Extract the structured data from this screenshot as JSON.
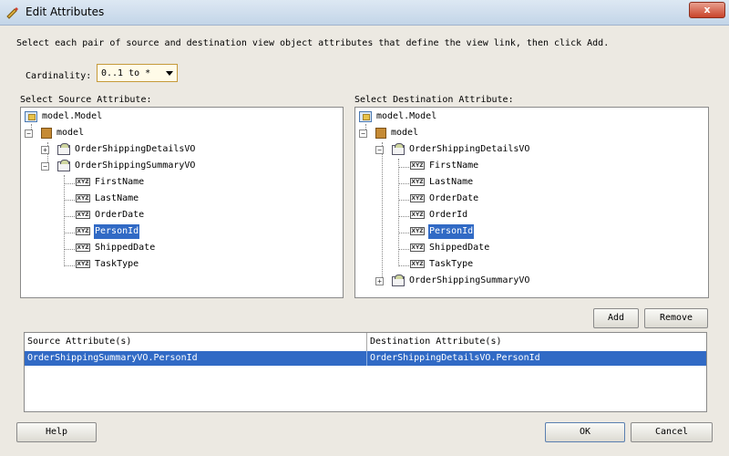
{
  "window": {
    "title": "Edit Attributes",
    "close_label": "x"
  },
  "instructions": "Select each pair of source and destination view object attributes that define the view link, then click Add.",
  "cardinality": {
    "label": "Cardinality:",
    "value": "0..1 to *"
  },
  "source": {
    "label": "Select Source Attribute:",
    "nodes": [
      "model.Model",
      "model",
      "OrderShippingDetailsVO",
      "OrderShippingSummaryVO",
      "FirstName",
      "LastName",
      "OrderDate",
      "PersonId",
      "ShippedDate",
      "TaskType"
    ],
    "selected": "PersonId"
  },
  "destination": {
    "label": "Select Destination Attribute:",
    "nodes": [
      "model.Model",
      "model",
      "OrderShippingDetailsVO",
      "FirstName",
      "LastName",
      "OrderDate",
      "OrderId",
      "PersonId",
      "ShippedDate",
      "TaskType",
      "OrderShippingSummaryVO"
    ],
    "selected": "PersonId"
  },
  "attr_icon_text": "XYZ",
  "buttons": {
    "add": "Add",
    "remove": "Remove",
    "help": "Help",
    "ok": "OK",
    "cancel": "Cancel"
  },
  "table": {
    "headers": [
      "Source Attribute(s)",
      "Destination Attribute(s)"
    ],
    "rows": [
      [
        "OrderShippingSummaryVO.PersonId",
        "OrderShippingDetailsVO.PersonId"
      ]
    ]
  }
}
